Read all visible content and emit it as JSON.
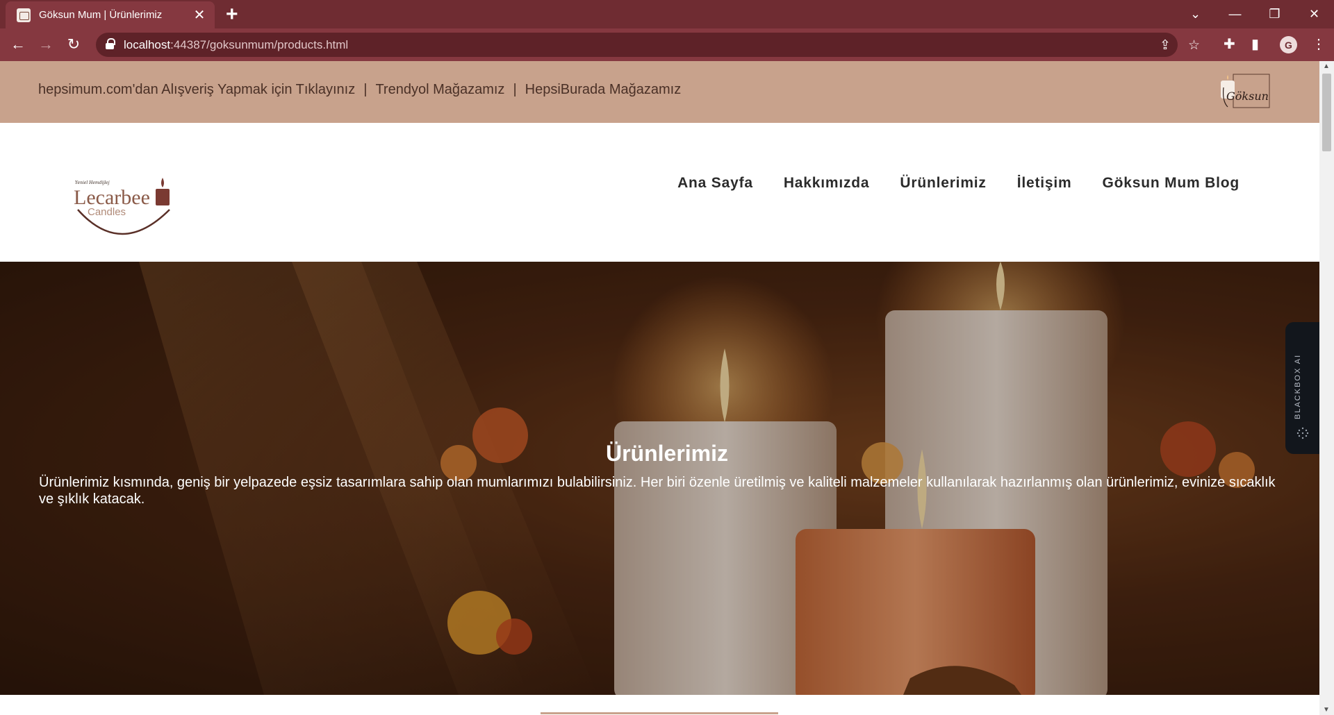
{
  "browser": {
    "tab_title": "Göksun Mum | Ürünlerimiz",
    "new_tab": "+",
    "url_host": "localhost",
    "url_rest": ":44387/goksunmum/products.html",
    "profile_initial": "G"
  },
  "top_links": {
    "hepsimum": "hepsimum.com'dan Alışveriş Yapmak için Tıklayınız",
    "trendyol": "Trendyol Mağazamız",
    "hepsiburada": "HepsiBurada Mağazamız",
    "separator": "|"
  },
  "brand": {
    "small_logo_text": "Göksun",
    "main_logo_script": "Yeniel Hemdijlej",
    "main_logo_name": "Lecarbee",
    "main_logo_sub": "Candles"
  },
  "menu": [
    "Ana Sayfa",
    "Hakkımızda",
    "Ürünlerimiz",
    "İletişim",
    "Göksun Mum Blog"
  ],
  "hero": {
    "title": "Ürünlerimiz",
    "description": "Ürünlerimiz kısmında, geniş bir yelpazede eşsiz tasarımlara sahip olan mumlarımızı bulabilirsiniz. Her biri özenle üretilmiş ve kaliteli malzemeler kullanılarak hazırlanmış olan ürünlerimiz, evinize sıcaklık ve şıklık katacak."
  },
  "widget": {
    "label": "BLACKBOX AI"
  },
  "colors": {
    "tabbar": "#6f2c32",
    "addrbar": "#853840",
    "topstrip": "#c8a28c",
    "accent": "#c8a28c"
  }
}
